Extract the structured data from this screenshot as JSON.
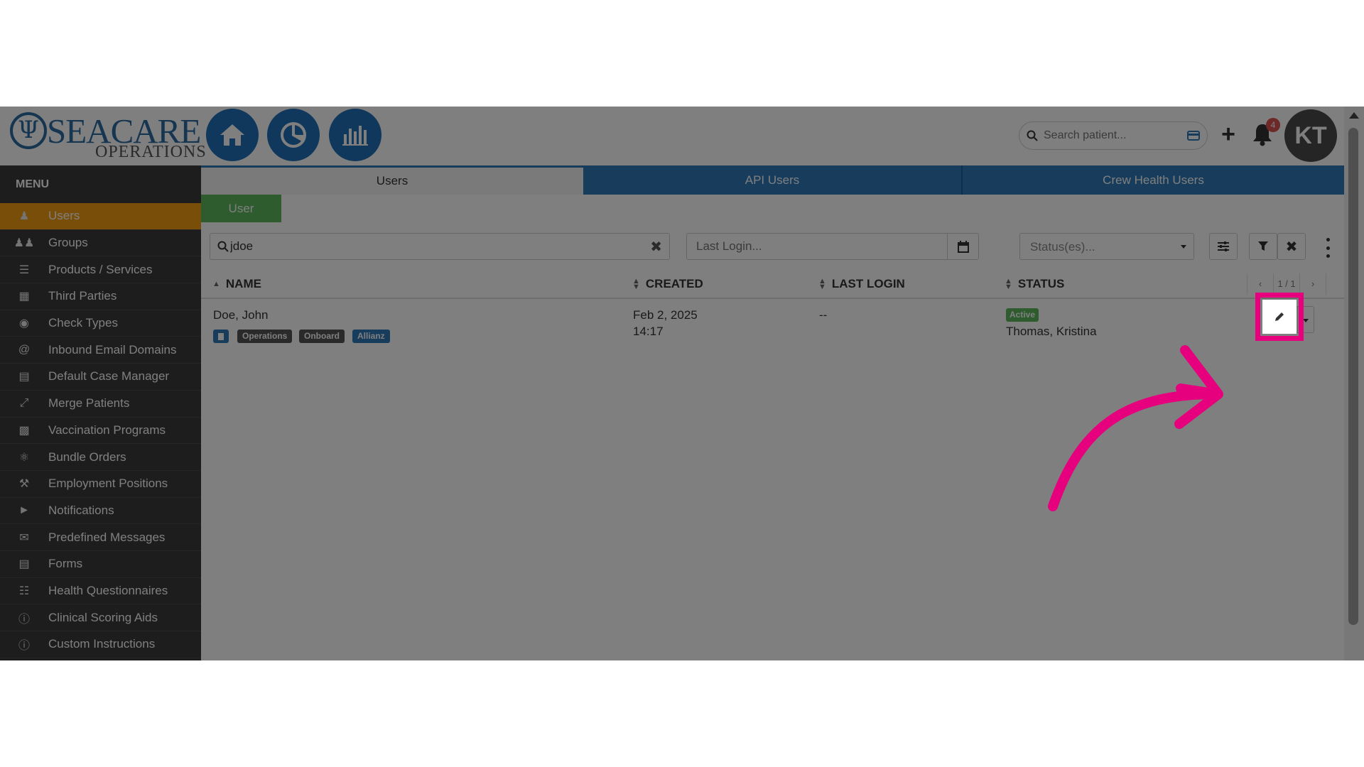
{
  "header": {
    "logo_title": "SEACARE",
    "logo_subtitle": "OPERATIONS",
    "nav_buttons": [
      {
        "icon": "home-icon"
      },
      {
        "icon": "pie-chart-icon"
      },
      {
        "icon": "bar-chart-icon"
      }
    ],
    "search_placeholder": "Search patient...",
    "notification_count": "4",
    "avatar_initials": "KT"
  },
  "sidebar": {
    "title": "MENU",
    "items": [
      {
        "label": "Users",
        "icon": "user-icon",
        "active": true
      },
      {
        "label": "Groups",
        "icon": "users-icon"
      },
      {
        "label": "Products / Services",
        "icon": "list-icon"
      },
      {
        "label": "Third Parties",
        "icon": "building-icon"
      },
      {
        "label": "Check Types",
        "icon": "camera-icon"
      },
      {
        "label": "Inbound Email Domains",
        "icon": "at-icon"
      },
      {
        "label": "Default Case Manager",
        "icon": "id-card-icon"
      },
      {
        "label": "Merge Patients",
        "icon": "compress-icon"
      },
      {
        "label": "Vaccination Programs",
        "icon": "briefcase-icon"
      },
      {
        "label": "Bundle Orders",
        "icon": "stethoscope-icon"
      },
      {
        "label": "Employment Positions",
        "icon": "wrench-icon"
      },
      {
        "label": "Notifications",
        "icon": "bullhorn-icon"
      },
      {
        "label": "Predefined Messages",
        "icon": "envelope-icon"
      },
      {
        "label": "Forms",
        "icon": "file-icon"
      },
      {
        "label": "Health Questionnaires",
        "icon": "list-alt-icon"
      },
      {
        "label": "Clinical Scoring Aids",
        "icon": "info-icon"
      },
      {
        "label": "Custom Instructions",
        "icon": "info-icon"
      }
    ]
  },
  "tabs": [
    "Users",
    "API Users",
    "Crew Health Users"
  ],
  "subtab": "User",
  "filters": {
    "search_value": "jdoe",
    "last_login_placeholder": "Last Login...",
    "status_placeholder": "Status(es)..."
  },
  "table": {
    "columns": [
      "NAME",
      "CREATED",
      "LAST LOGIN",
      "STATUS"
    ],
    "pager": {
      "prev": "‹",
      "page": "1 / 1",
      "next": "›"
    },
    "rows": [
      {
        "name": "Doe, John",
        "tags": [
          "Operations",
          "Onboard",
          "Allianz"
        ],
        "created_date": "Feb 2, 2025",
        "created_time": "14:17",
        "last_login": "--",
        "status": "Active",
        "status_by": "Thomas, Kristina"
      }
    ]
  },
  "colors": {
    "brand_blue": "#2e79b9",
    "active_menu": "#f39c12",
    "success_green": "#5cb85c",
    "highlight_pink": "#e6007e"
  }
}
